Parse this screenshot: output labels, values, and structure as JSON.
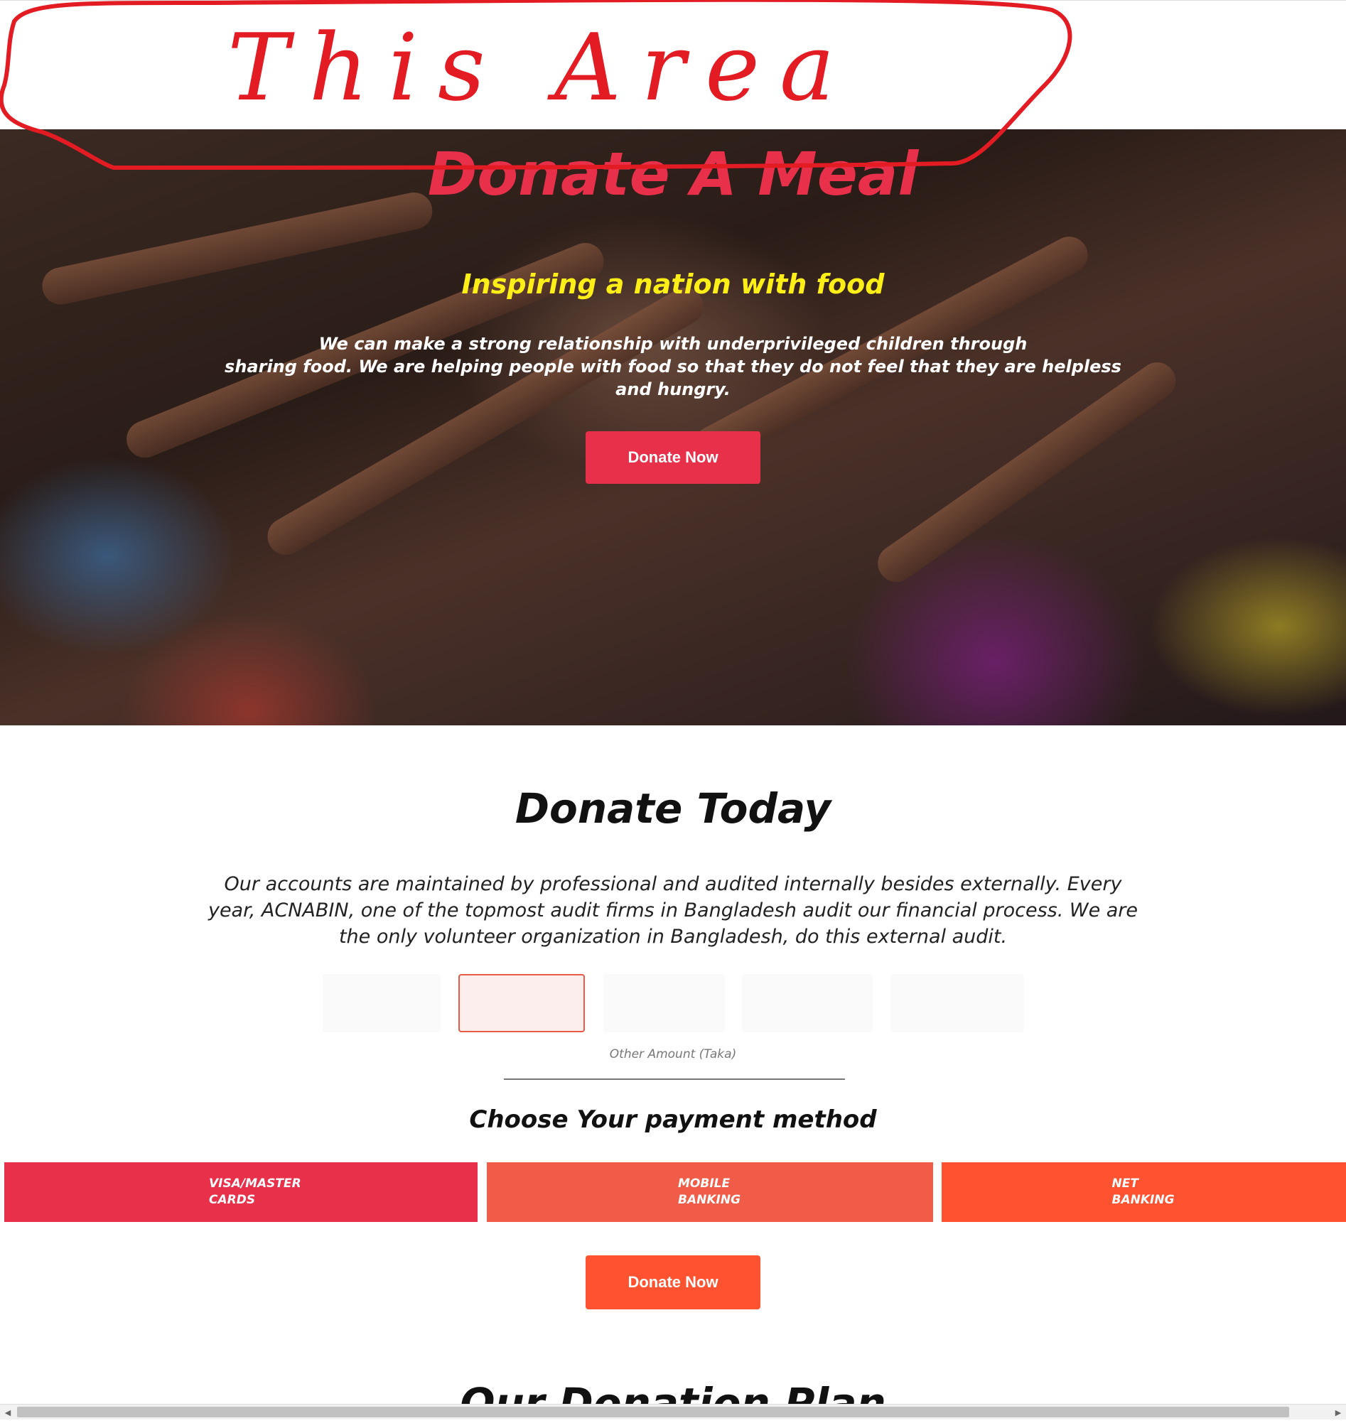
{
  "hero": {
    "title": "Donate A Meal",
    "subtitle": "Inspiring a nation with food",
    "text_line1": "We can make a strong relationship with underprivileged children through",
    "text_line2": "sharing food. We are helping people with food so that they do not feel that they are helpless and hungry.",
    "button_label": "Donate Now"
  },
  "annotation": {
    "text": "This Area",
    "color": "#e31b23"
  },
  "donate_section": {
    "title": "Donate Today",
    "text": "Our accounts are maintained by professional and audited internally besides externally. Every year, ACNABIN, one of the topmost audit firms in Bangladesh audit our financial process. We are the only volunteer organization in Bangladesh, do this external audit.",
    "other_amount_label": "Other Amount (Taka)"
  },
  "payment": {
    "title": "Choose Your payment method",
    "visa_label": "VISA/MASTER CARDS",
    "mobile_label": "MOBILE BANKING",
    "net_label": "NET BANKING",
    "button_label": "Donate Now"
  },
  "next_section": {
    "title": "Our Donation Plan"
  },
  "colors": {
    "primary": "#e8304a",
    "secondary": "#f05c48",
    "accent": "#fe5230",
    "subtitle": "#ffef16"
  },
  "icons": {
    "scroll_left": "arrow-left-icon",
    "scroll_right": "arrow-right-icon"
  }
}
